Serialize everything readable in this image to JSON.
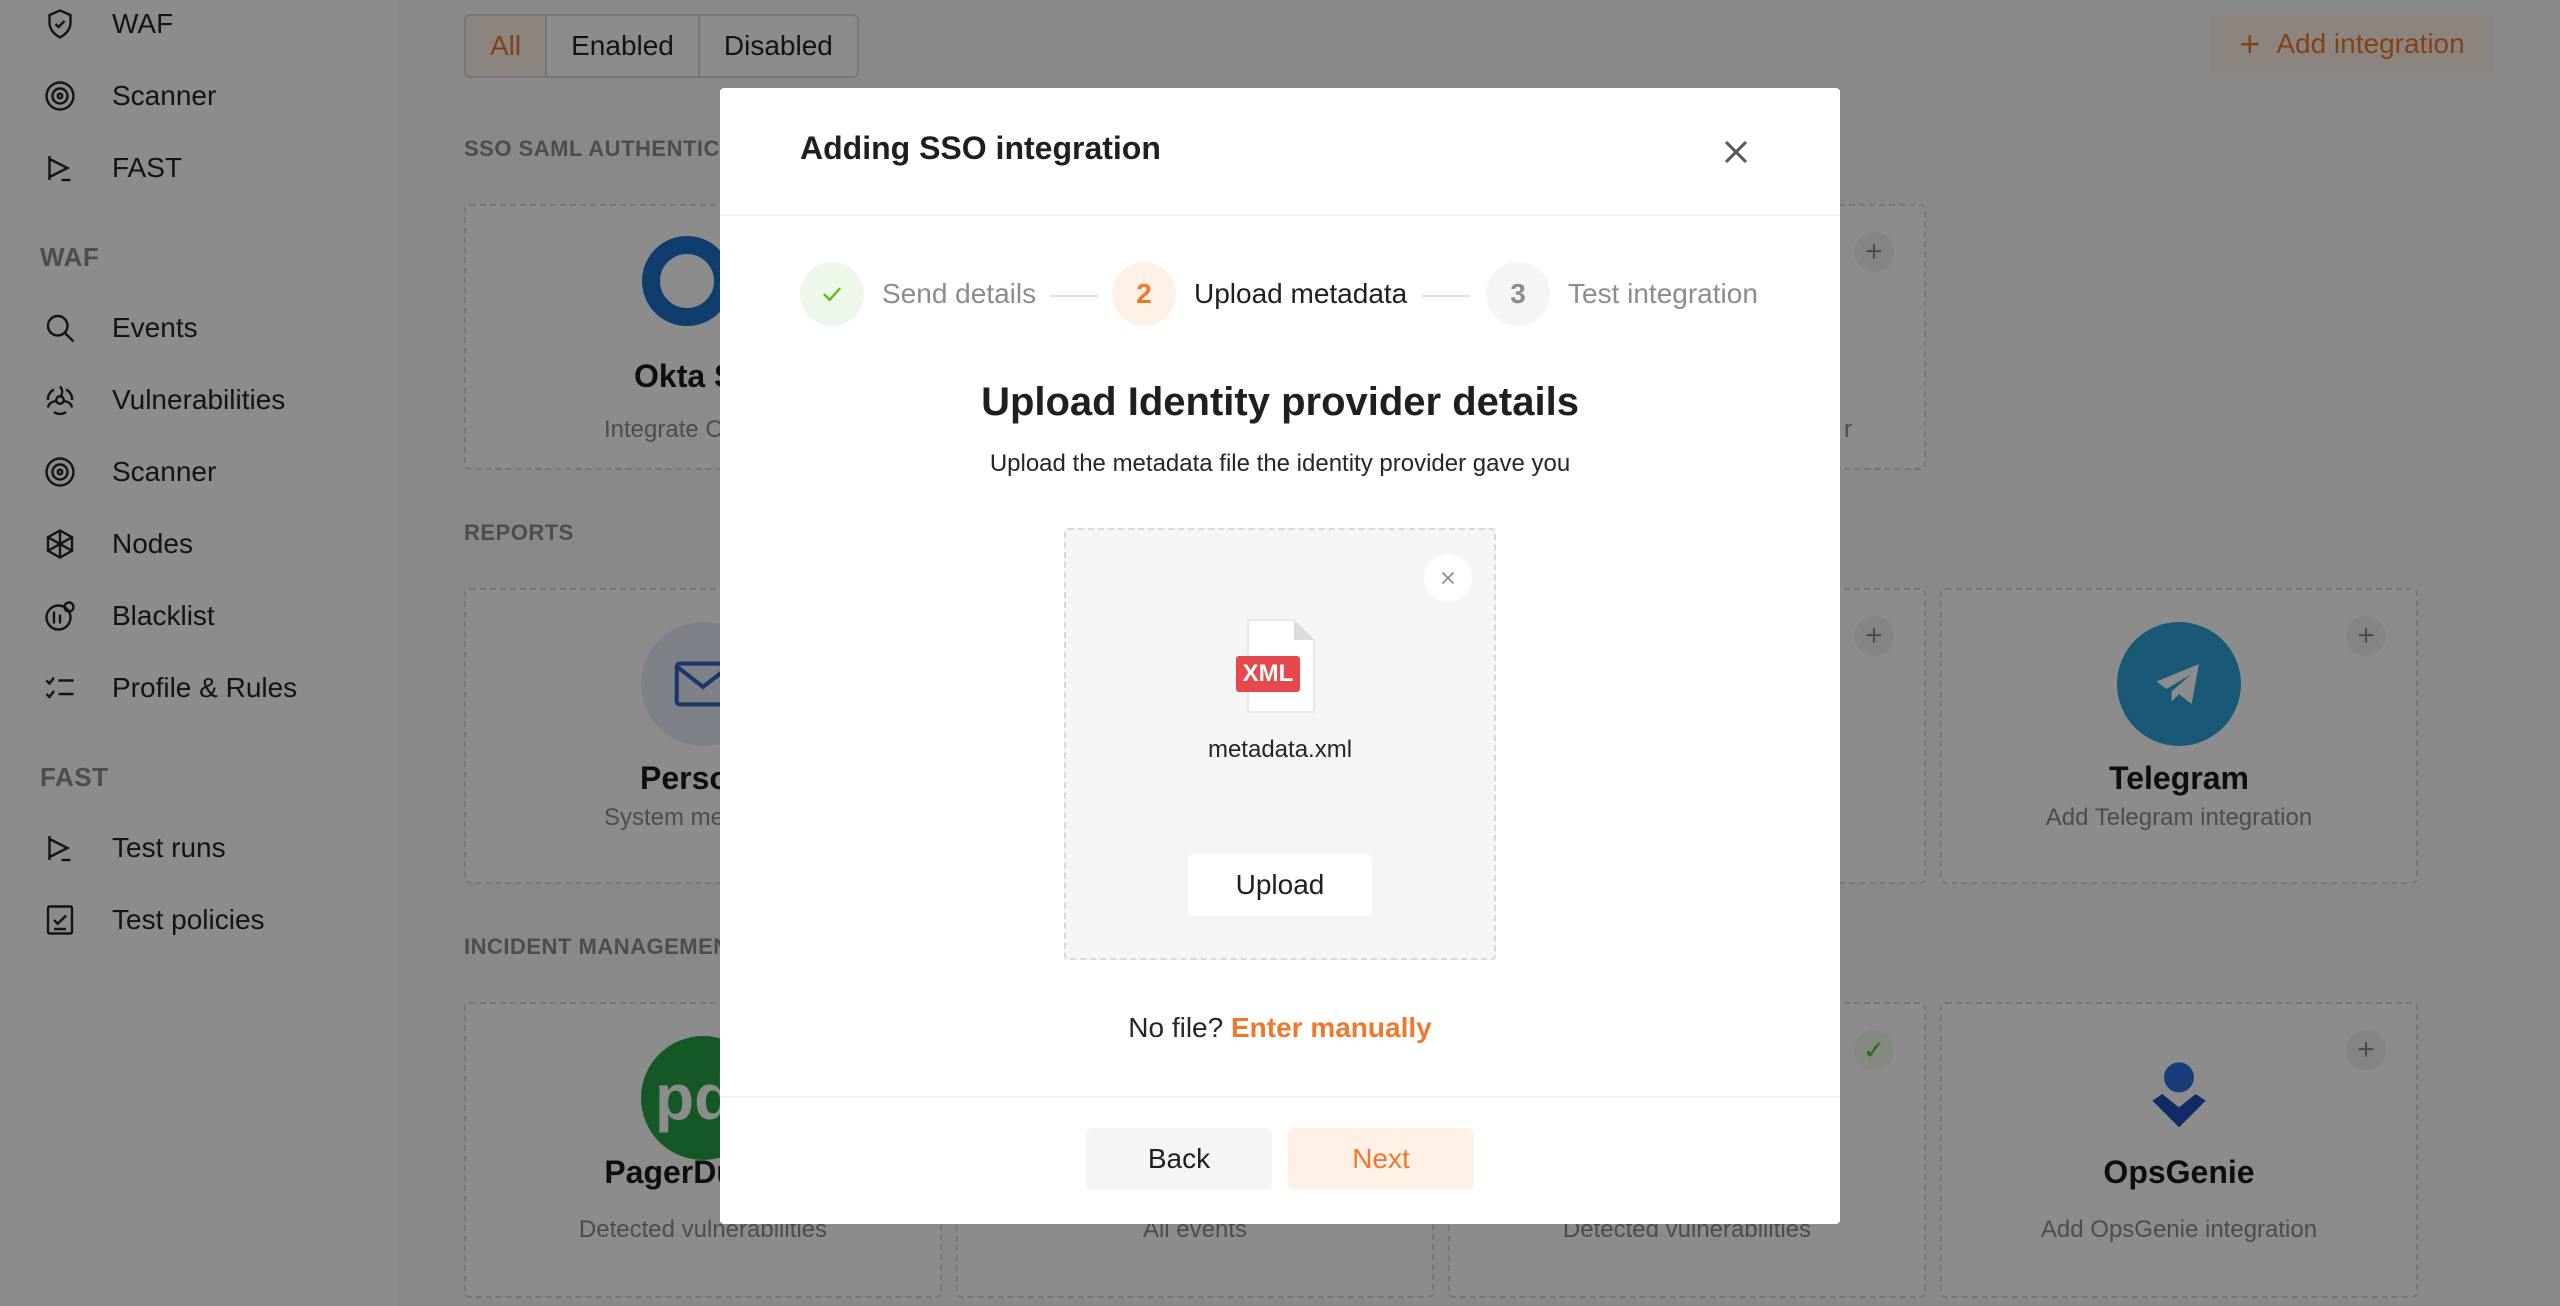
{
  "sidebar": {
    "top_items": [
      {
        "label": "WAF",
        "icon": "shield-icon"
      },
      {
        "label": "Scanner",
        "icon": "scanner-icon"
      },
      {
        "label": "FAST",
        "icon": "fast-icon"
      }
    ],
    "sections": [
      {
        "title": "WAF",
        "items": [
          {
            "label": "Events",
            "icon": "search-icon"
          },
          {
            "label": "Vulnerabilities",
            "icon": "biohazard-icon"
          },
          {
            "label": "Scanner",
            "icon": "scanner-icon"
          },
          {
            "label": "Nodes",
            "icon": "nodes-icon"
          },
          {
            "label": "Blacklist",
            "icon": "blacklist-icon"
          },
          {
            "label": "Profile & Rules",
            "icon": "rules-icon"
          }
        ]
      },
      {
        "title": "FAST",
        "items": [
          {
            "label": "Test runs",
            "icon": "play-icon"
          },
          {
            "label": "Test policies",
            "icon": "policy-icon"
          }
        ]
      }
    ]
  },
  "filters": {
    "all": "All",
    "enabled": "Enabled",
    "disabled": "Disabled",
    "active": "All"
  },
  "add_integration": "Add integration",
  "sections": {
    "sso": "SSO SAML AUTHENTICA",
    "reports": "REPORTS",
    "incident": "INCIDENT MANAGEMEN"
  },
  "cards": {
    "okta": {
      "name": "Okta S",
      "desc": "Integrate O"
    },
    "sso_right": {
      "desc": "r"
    },
    "personal": {
      "name": "Perso",
      "desc": "System me"
    },
    "telegram": {
      "name": "Telegram",
      "desc": "Add Telegram integration"
    },
    "pagerduty": {
      "name": "PagerDuty in",
      "desc": "Detected vulnerabilities"
    },
    "incident2": {
      "desc": "All events"
    },
    "incident3": {
      "desc": "Detected vulnerabilities"
    },
    "opsgenie": {
      "name": "OpsGenie",
      "desc": "Add OpsGenie integration"
    }
  },
  "modal": {
    "title": "Adding SSO integration",
    "steps": [
      {
        "number": "",
        "label": "Send details",
        "state": "done"
      },
      {
        "number": "2",
        "label": "Upload metadata",
        "state": "active"
      },
      {
        "number": "3",
        "label": "Test integration",
        "state": "pending"
      }
    ],
    "heading": "Upload Identity provider details",
    "subheading": "Upload the metadata file the identity provider gave you",
    "file": {
      "type": "XML",
      "name": "metadata.xml"
    },
    "upload_label": "Upload",
    "no_file_text": "No file?",
    "enter_manually": "Enter manually",
    "back": "Back",
    "next": "Next"
  },
  "colors": {
    "accent": "#f0782d",
    "accent_bg": "#fff1e6",
    "success": "#52c41a",
    "xml_badge": "#e5484d"
  }
}
